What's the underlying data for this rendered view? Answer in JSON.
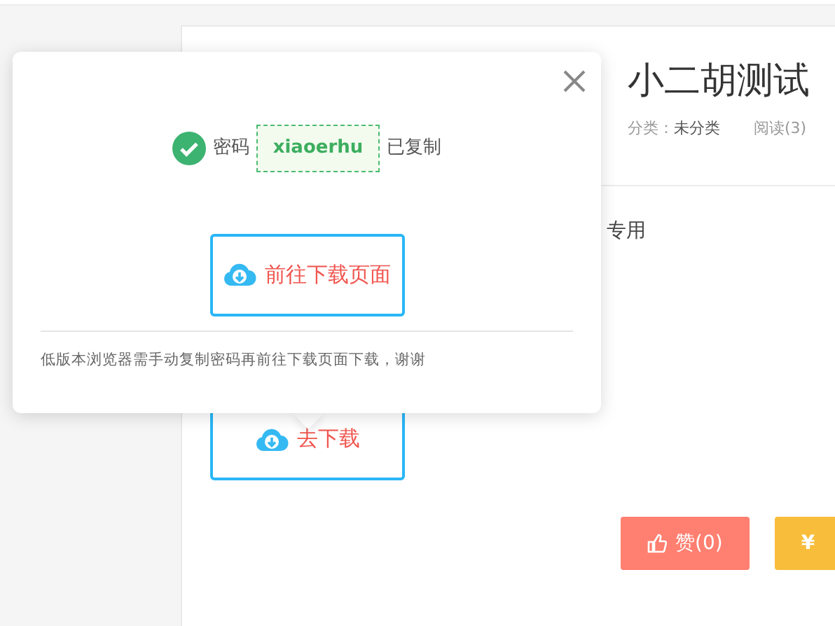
{
  "article": {
    "title": "小二胡测试",
    "meta": [
      {
        "label": "分类：",
        "value": "未分类"
      },
      {
        "value": "阅读(3)"
      }
    ],
    "body_visible": "专用",
    "download_button": "去下载",
    "actions": [
      {
        "kind": "like",
        "label": "赞(0)"
      },
      {
        "kind": "tip",
        "symbol": "¥"
      }
    ]
  },
  "popup": {
    "status_prefix": "密码",
    "password": "xiaoerhu",
    "status_suffix": "已复制",
    "go_button": "前往下载页面",
    "note": "低版本浏览器需手动复制密码再前往下载页面下载，谢谢"
  }
}
